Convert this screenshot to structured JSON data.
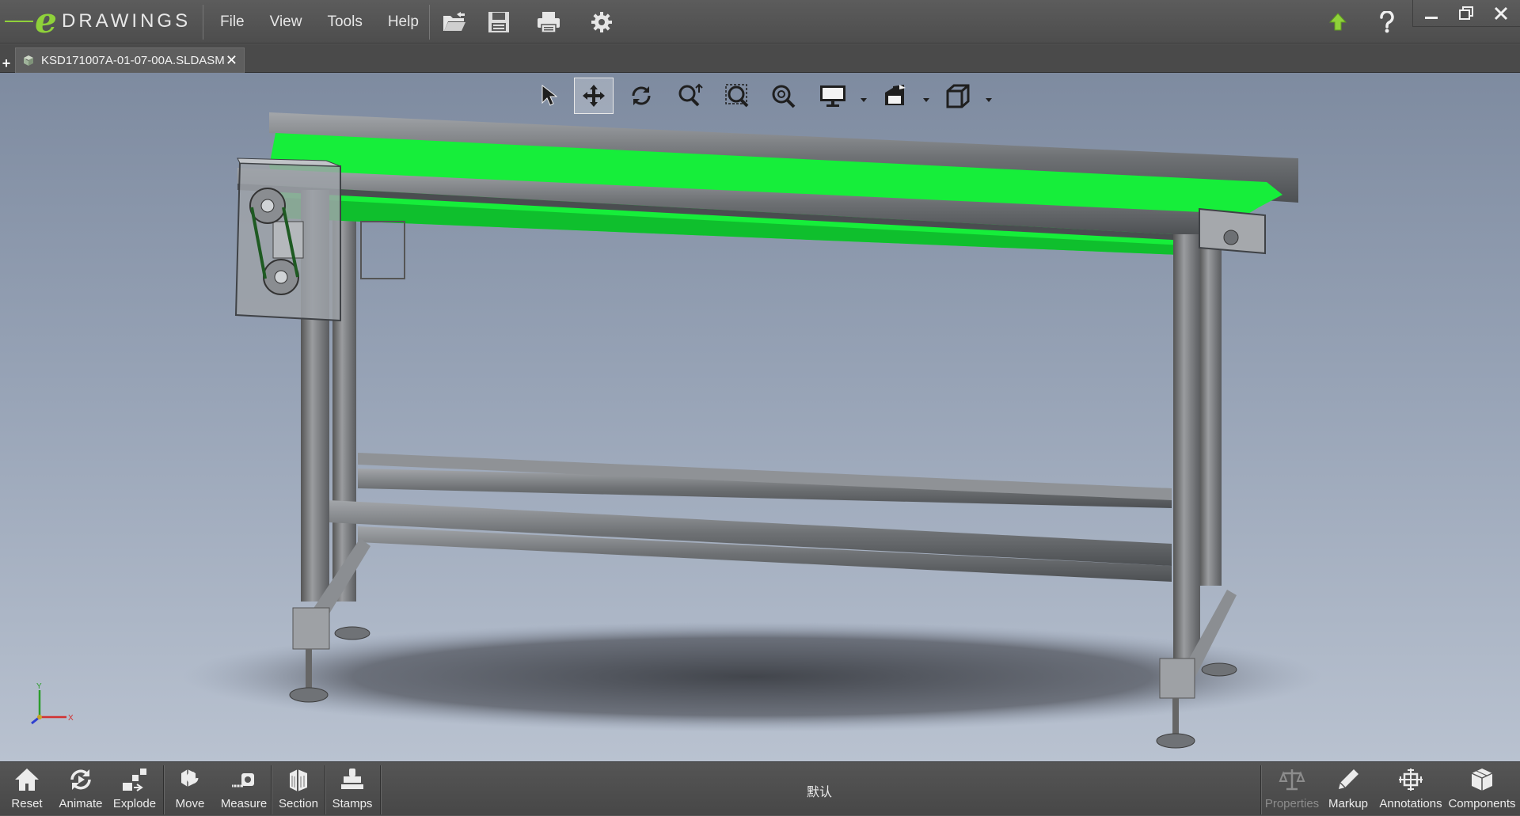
{
  "app": {
    "logo_text": "DRAWINGS",
    "logo_letter": "e"
  },
  "menu": {
    "items": [
      {
        "label": "File"
      },
      {
        "label": "View"
      },
      {
        "label": "Tools"
      },
      {
        "label": "Help"
      }
    ],
    "quick_icons": [
      "open-icon",
      "save-icon",
      "print-icon",
      "settings-icon"
    ],
    "right_icons": [
      "upgrade-arrow-icon",
      "help-icon"
    ]
  },
  "window_controls": [
    "minimize-icon",
    "restore-icon",
    "close-icon"
  ],
  "tabs": {
    "new_tab_label": "+",
    "active": {
      "label": "KSD171007A-01-07-00A.SLDASM",
      "close": "✕"
    }
  },
  "view_toolbar": {
    "tools": [
      "select-icon",
      "pan-icon",
      "rotate-icon",
      "zoom-to-fit-icon",
      "zoom-to-area-icon",
      "zoom-icon",
      "display-style-icon",
      "view-orientation-icon",
      "standard-views-icon"
    ],
    "active_tool": "pan-icon"
  },
  "triad": {
    "x_label": "X",
    "y_label": "Y"
  },
  "bottom_toolbar": {
    "left_buttons": [
      {
        "label": "Reset",
        "icon": "home-icon"
      },
      {
        "label": "Animate",
        "icon": "animate-icon"
      },
      {
        "label": "Explode",
        "icon": "explode-icon"
      },
      {
        "label": "Move",
        "icon": "move-icon"
      },
      {
        "label": "Measure",
        "icon": "measure-icon"
      },
      {
        "label": "Section",
        "icon": "section-icon"
      },
      {
        "label": "Stamps",
        "icon": "stamps-icon"
      }
    ],
    "configuration": "默认",
    "right_buttons": [
      {
        "label": "Properties",
        "icon": "scale-icon",
        "enabled": false
      },
      {
        "label": "Markup",
        "icon": "pencil-icon",
        "enabled": true
      },
      {
        "label": "Annotations",
        "icon": "annotations-icon",
        "enabled": true
      },
      {
        "label": "Components",
        "icon": "components-icon",
        "enabled": true
      }
    ]
  },
  "colors": {
    "belt": "#16ee3a",
    "frame": "#7b7d80",
    "logo_green": "#8fd13a",
    "upgrade_arrow": "#8fd13a"
  }
}
